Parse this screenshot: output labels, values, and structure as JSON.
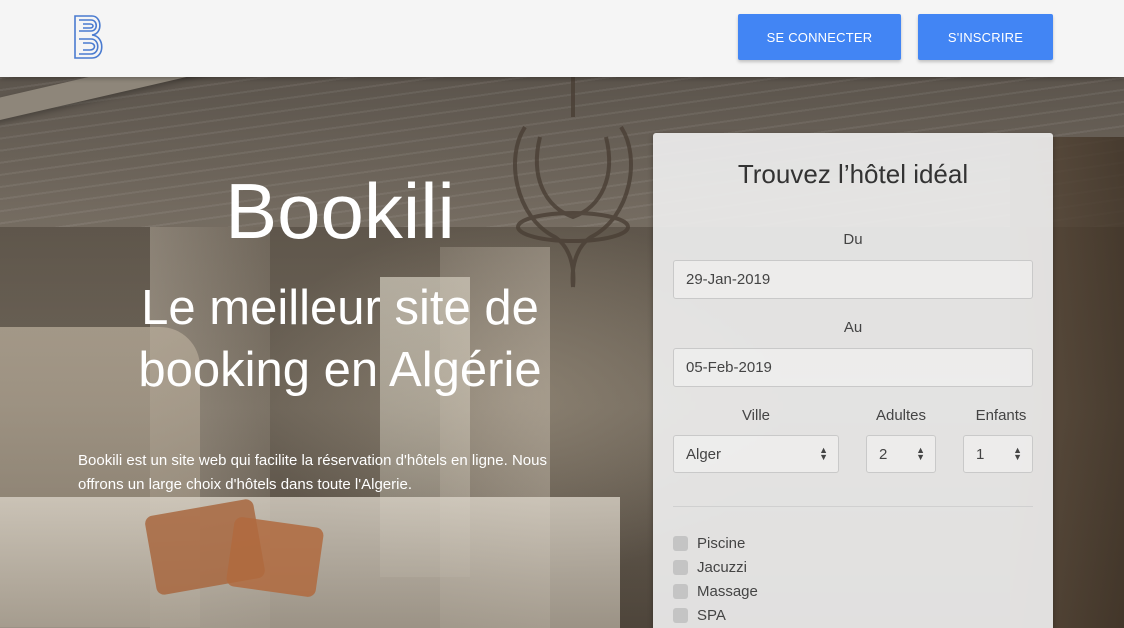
{
  "header": {
    "login_label": "SE CONNECTER",
    "signup_label": "S'INSCRIRE",
    "brand_color": "#4285f4",
    "logo_icon": "bookili-b-logo"
  },
  "hero": {
    "brand": "Bookili",
    "tagline": "Le meilleur site de booking en Algérie",
    "description": "Bookili est un site web qui facilite la réservation d'hôtels en ligne. Nous offrons un large choix d'hôtels dans toute l'Algerie."
  },
  "search": {
    "title": "Trouvez l’hôtel idéal",
    "from_label": "Du",
    "from_value": "29-Jan-2019",
    "to_label": "Au",
    "to_value": "05-Feb-2019",
    "city_label": "Ville",
    "city_value": "Alger",
    "adults_label": "Adultes",
    "adults_value": "2",
    "children_label": "Enfants",
    "children_value": "1",
    "amenities": [
      {
        "label": "Piscine",
        "checked": false
      },
      {
        "label": "Jacuzzi",
        "checked": false
      },
      {
        "label": "Massage",
        "checked": false
      },
      {
        "label": "SPA",
        "checked": false
      }
    ]
  }
}
